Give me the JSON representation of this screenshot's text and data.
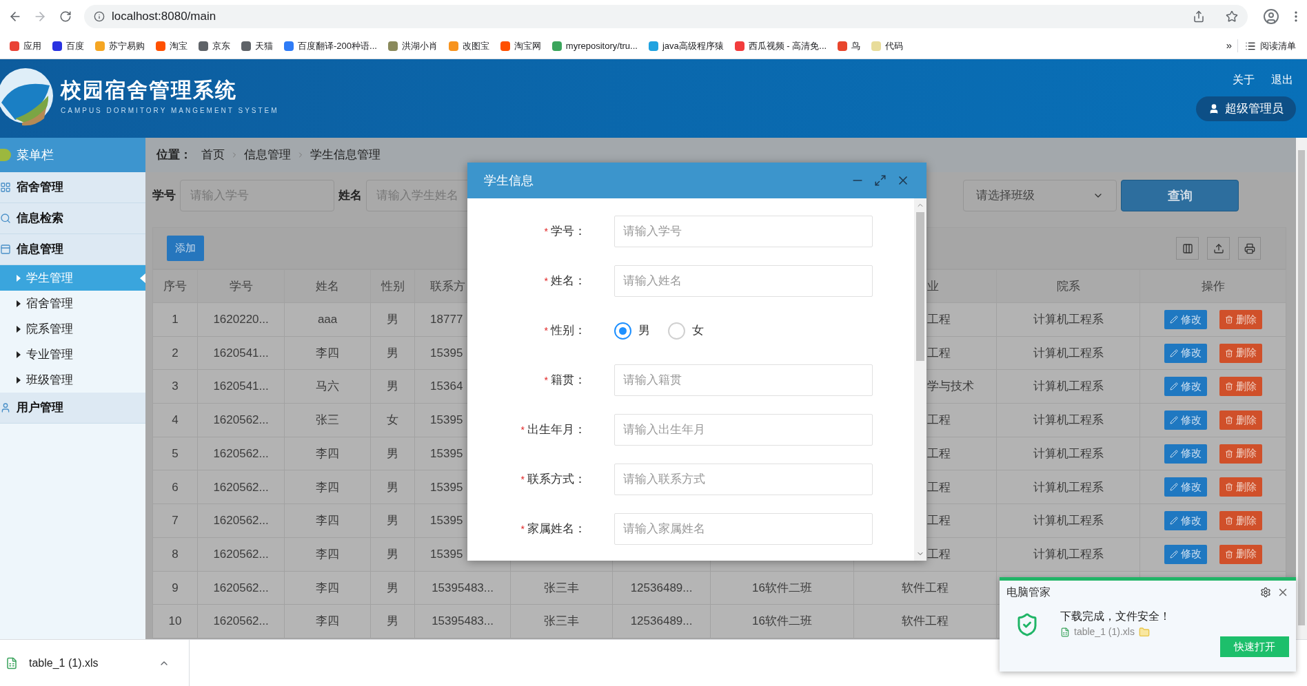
{
  "browser": {
    "url": "localhost:8080/main",
    "bookmarks": [
      {
        "label": "应用",
        "color": "#e94235"
      },
      {
        "label": "百度",
        "color": "#2932e1"
      },
      {
        "label": "苏宁易购",
        "color": "#f5a623"
      },
      {
        "label": "淘宝",
        "color": "#ff5000"
      },
      {
        "label": "京东",
        "color": "#5f6368"
      },
      {
        "label": "天猫",
        "color": "#5f6368"
      },
      {
        "label": "百度翻译-200种语...",
        "color": "#2e7bf6"
      },
      {
        "label": "洪湖小肖",
        "color": "#8a8a5c"
      },
      {
        "label": "改图宝",
        "color": "#f7931e"
      },
      {
        "label": "淘宝网",
        "color": "#ff5000"
      },
      {
        "label": "myrepository/tru...",
        "color": "#3ba55c"
      },
      {
        "label": "java高级程序猿",
        "color": "#1fa2e0"
      },
      {
        "label": "西瓜视频 - 高清免...",
        "color": "#f23c3c"
      },
      {
        "label": "鸟",
        "color": "#e8452c"
      },
      {
        "label": "代码",
        "color": "#e8dc9a"
      }
    ],
    "overflow": "»",
    "reading_list": "阅读清单"
  },
  "header": {
    "title": "校园宿舍管理系统",
    "subtitle": "CAMPUS DORMITORY MANGEMENT SYSTEM",
    "links": [
      "关于",
      "退出"
    ],
    "user": "超级管理员"
  },
  "sidebar": {
    "title": "菜单栏",
    "items": [
      {
        "kind": "dorm",
        "label": "宿舍管理"
      },
      {
        "kind": "search",
        "label": "信息检索"
      },
      {
        "kind": "info",
        "label": "信息管理",
        "children": [
          {
            "label": "学生管理",
            "selected": true
          },
          {
            "label": "宿舍管理",
            "selected": false
          },
          {
            "label": "院系管理",
            "selected": false
          },
          {
            "label": "专业管理",
            "selected": false
          },
          {
            "label": "班级管理",
            "selected": false
          }
        ]
      },
      {
        "kind": "user",
        "label": "用户管理"
      }
    ]
  },
  "breadcrumb": {
    "label": "位置：",
    "items": [
      "首页",
      "信息管理",
      "学生信息管理"
    ]
  },
  "search": {
    "fields": [
      {
        "label": "学号",
        "placeholder": "请输入学号"
      },
      {
        "label": "姓名",
        "placeholder": "请输入学生姓名"
      }
    ],
    "class_select": {
      "placeholder": "请选择班级"
    },
    "button": "查询"
  },
  "toolbar": {
    "add": "添加"
  },
  "table": {
    "header_covered": true,
    "columns": [
      {
        "label": "序号"
      },
      {
        "label": "学号"
      },
      {
        "label": "姓名"
      },
      {
        "label": "性别"
      },
      {
        "label": "联系方"
      },
      {
        "label": "业"
      },
      {
        "label": "院系"
      },
      {
        "label": "操作"
      }
    ],
    "rows": [
      {
        "covered": true,
        "no": "1",
        "id": "1620220...",
        "name": "aaa",
        "gender": "男",
        "contact": "18777",
        "major": "工程",
        "department": "计算机工程系",
        "actions": [
          {
            "kind": "edit",
            "label": "修改"
          },
          {
            "kind": "delete",
            "label": "删除"
          }
        ]
      },
      {
        "covered": true,
        "no": "2",
        "id": "1620541...",
        "name": "李四",
        "gender": "男",
        "contact": "15395",
        "major": "工程",
        "department": "计算机工程系",
        "actions": [
          {
            "kind": "edit",
            "label": "修改"
          },
          {
            "kind": "delete",
            "label": "删除"
          }
        ]
      },
      {
        "covered": true,
        "no": "3",
        "id": "1620541...",
        "name": "马六",
        "gender": "男",
        "contact": "15364",
        "major": "学与技术",
        "department": "计算机工程系",
        "actions": [
          {
            "kind": "edit",
            "label": "修改"
          },
          {
            "kind": "delete",
            "label": "删除"
          }
        ]
      },
      {
        "covered": true,
        "no": "4",
        "id": "1620562...",
        "name": "张三",
        "gender": "女",
        "contact": "15395",
        "major": "工程",
        "department": "计算机工程系",
        "actions": [
          {
            "kind": "edit",
            "label": "修改"
          },
          {
            "kind": "delete",
            "label": "删除"
          }
        ]
      },
      {
        "covered": true,
        "no": "5",
        "id": "1620562...",
        "name": "李四",
        "gender": "男",
        "contact": "15395",
        "major": "工程",
        "department": "计算机工程系",
        "actions": [
          {
            "kind": "edit",
            "label": "修改"
          },
          {
            "kind": "delete",
            "label": "删除"
          }
        ]
      },
      {
        "covered": true,
        "no": "6",
        "id": "1620562...",
        "name": "李四",
        "gender": "男",
        "contact": "15395",
        "major": "工程",
        "department": "计算机工程系",
        "actions": [
          {
            "kind": "edit",
            "label": "修改"
          },
          {
            "kind": "delete",
            "label": "删除"
          }
        ]
      },
      {
        "covered": true,
        "no": "7",
        "id": "1620562...",
        "name": "李四",
        "gender": "男",
        "contact": "15395",
        "major": "工程",
        "department": "计算机工程系",
        "actions": [
          {
            "kind": "edit",
            "label": "修改"
          },
          {
            "kind": "delete",
            "label": "删除"
          }
        ]
      },
      {
        "covered": true,
        "no": "8",
        "id": "1620562...",
        "name": "李四",
        "gender": "男",
        "contact": "15395",
        "major": "工程",
        "department": "计算机工程系",
        "actions": [
          {
            "kind": "edit",
            "label": "修改"
          },
          {
            "kind": "delete",
            "label": "删除"
          }
        ]
      },
      {
        "covered": false,
        "no": "9",
        "id": "1620562...",
        "name": "李四",
        "gender": "男",
        "contact": "15395483...",
        "family_name": "张三丰",
        "family_contact": "12536489...",
        "class": "16软件二班",
        "major": "软件工程"
      },
      {
        "covered": false,
        "no": "10",
        "id": "1620562...",
        "name": "李四",
        "gender": "男",
        "contact": "15395483...",
        "family_name": "张三丰",
        "family_contact": "12536489...",
        "class": "16软件二班",
        "major": "软件工程"
      }
    ]
  },
  "dialog": {
    "title": "学生信息",
    "fields": [
      {
        "kind": "text",
        "marker": "*",
        "label": "学号：",
        "placeholder": "请输入学号"
      },
      {
        "kind": "text",
        "marker": "*",
        "label": "姓名：",
        "placeholder": "请输入姓名"
      },
      {
        "kind": "radio",
        "marker": "*",
        "label": "性别：",
        "options": [
          {
            "label": "男",
            "selected": true
          },
          {
            "label": "女",
            "selected": false
          }
        ]
      },
      {
        "kind": "text",
        "marker": "*",
        "label": "籍贯：",
        "placeholder": "请输入籍贯"
      },
      {
        "kind": "text",
        "marker": "*",
        "label": "出生年月：",
        "placeholder": "请输入出生年月"
      },
      {
        "kind": "text",
        "marker": "*",
        "label": "联系方式：",
        "placeholder": "请输入联系方式"
      },
      {
        "kind": "text",
        "marker": "*",
        "label": "家属姓名：",
        "placeholder": "请输入家属姓名"
      }
    ]
  },
  "download_bar": {
    "file": "table_1 (1).xls"
  },
  "notification": {
    "app": "电脑管家",
    "message": "下载完成，文件安全！",
    "file": "table_1 (1).xls",
    "button": "快速打开"
  }
}
